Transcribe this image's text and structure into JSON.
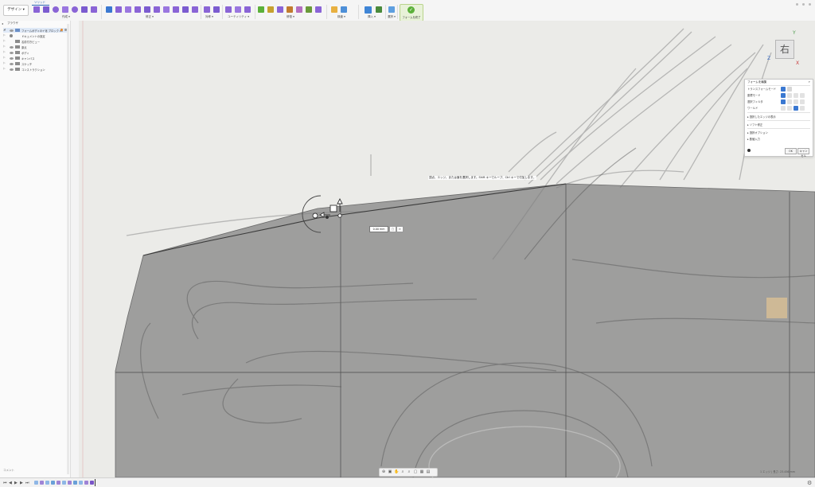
{
  "toolbar": {
    "workspace_label": "デザイン ▾",
    "active_tab": "ソリッド",
    "groups": [
      "作成 ▾",
      "修正 ▾",
      "対称 ▾",
      "ユーティリティ ▾",
      "修復 ▾",
      "検査 ▾",
      "挿入 ▾",
      "選択 ▾"
    ],
    "finish_label": "フォームを終了"
  },
  "browser": {
    "title": "ブラウザ",
    "nodes": [
      {
        "label": "フォームボディのイ化 ブロック v1"
      },
      {
        "label": "ドキュメントの設定"
      },
      {
        "label": "名前付きビュー"
      },
      {
        "label": "原点"
      },
      {
        "label": "ボディ"
      },
      {
        "label": "キャンバス"
      },
      {
        "label": "スケッチ"
      },
      {
        "label": "コンストラクション"
      }
    ],
    "footer": "コメント"
  },
  "canvas": {
    "selection_hint": "頂点、エッジ、または面を選択します。Shift キーでループ、Ctrl キーで付加します。",
    "dimension_value": "0.00 mm"
  },
  "viewcube": {
    "face_label": "右",
    "axis_y": "Y",
    "axis_z": "Z",
    "axis_x": "X"
  },
  "dialog": {
    "title": "フォームを編集",
    "rows": [
      "トランスフォームモード",
      "座標モード",
      "選択フィルタ",
      "ワールド"
    ],
    "sections": [
      "選択したエッジの表示",
      "ソフト修正",
      "選択オプション",
      "数値入力"
    ],
    "ok_label": "OK",
    "cancel_label": "キャンセル"
  },
  "status": {
    "readout": "1 エッジ | 長さ: 23.456 mm"
  },
  "colors": {
    "tool_purple": "#8a64d6",
    "tool_blue": "#3a78d1",
    "accent_green": "#5bb03a",
    "form_fill": "#7f7f7f"
  }
}
